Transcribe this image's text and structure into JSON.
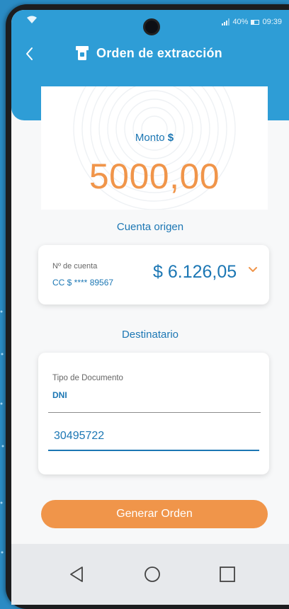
{
  "status_bar": {
    "battery": "40%",
    "time": "09:39"
  },
  "header": {
    "title": "Orden de extracción"
  },
  "amount": {
    "label": "Monto",
    "currency": "$",
    "value": "5000,00"
  },
  "source_account": {
    "section_title": "Cuenta origen",
    "account_number_label": "Nº de cuenta",
    "account_number": "CC $ **** 89567",
    "balance": "$ 6.126,05"
  },
  "recipient": {
    "section_title": "Destinatario",
    "document_type_label": "Tipo de Documento",
    "document_type_value": "DNI",
    "document_number": "30495722"
  },
  "actions": {
    "generate_label": "Generar Orden"
  },
  "colors": {
    "primary_blue": "#2e9dd6",
    "text_blue": "#1c77b4",
    "accent_orange": "#f0954a"
  },
  "icons": {
    "back": "chevron-left-icon",
    "title": "atm-icon",
    "dropdown": "chevron-down-icon",
    "nav_back": "triangle-back-icon",
    "nav_home": "circle-home-icon",
    "nav_recents": "square-recents-icon"
  }
}
